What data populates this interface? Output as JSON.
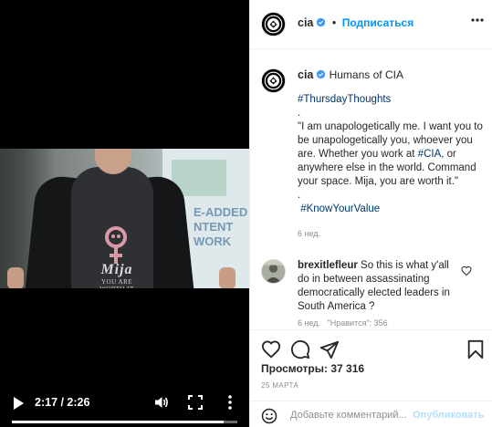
{
  "video": {
    "shirt_text": "Mija",
    "shirt_subtext": "YOU ARE WORTH IT",
    "wall_text": "E-ADDED\nNTENT\nWORK",
    "time": "2:17 / 2:26",
    "progress": 0.94,
    "icons": [
      "play-icon",
      "volume-icon",
      "fullscreen-icon",
      "more-vertical-icon"
    ]
  },
  "header": {
    "username": "cia",
    "separator": "•",
    "follow_label": "Подписаться"
  },
  "caption": {
    "username": "cia",
    "author_note": "Humans of CIA",
    "hashtag1": "#ThursdayThoughts",
    "dot1": ".",
    "quote_before": "\"I am unapologetically me. I want you to be unapologetically you, whoever you are. Whether you work at ",
    "quote_tag": "#CIA",
    "quote_after": ", or anywhere else in the world. Command your space. Mija, you are worth it.\"",
    "dot2": ".",
    "hashtag2": "#KnowYourValue",
    "ago": "6 нед."
  },
  "comment": {
    "username": "brexitlefleur",
    "text": "So this is what y'all do in between assassinating democratically elected leaders in South America ?",
    "meta": "6 нед.   \"Нравится\": 356"
  },
  "actions": {
    "views": "Просмотры: 37 316",
    "date": "25 МАРТА",
    "icons": [
      "heart-icon",
      "comment-icon",
      "share-icon",
      "bookmark-icon"
    ]
  },
  "comment_box": {
    "placeholder": "Добавьте комментарий...",
    "post_label": "Опубликовать"
  },
  "colors": {
    "link": "#0095f6",
    "hashtag": "#00376b",
    "muted": "#8e8e8e",
    "verified": "#3897f0"
  }
}
